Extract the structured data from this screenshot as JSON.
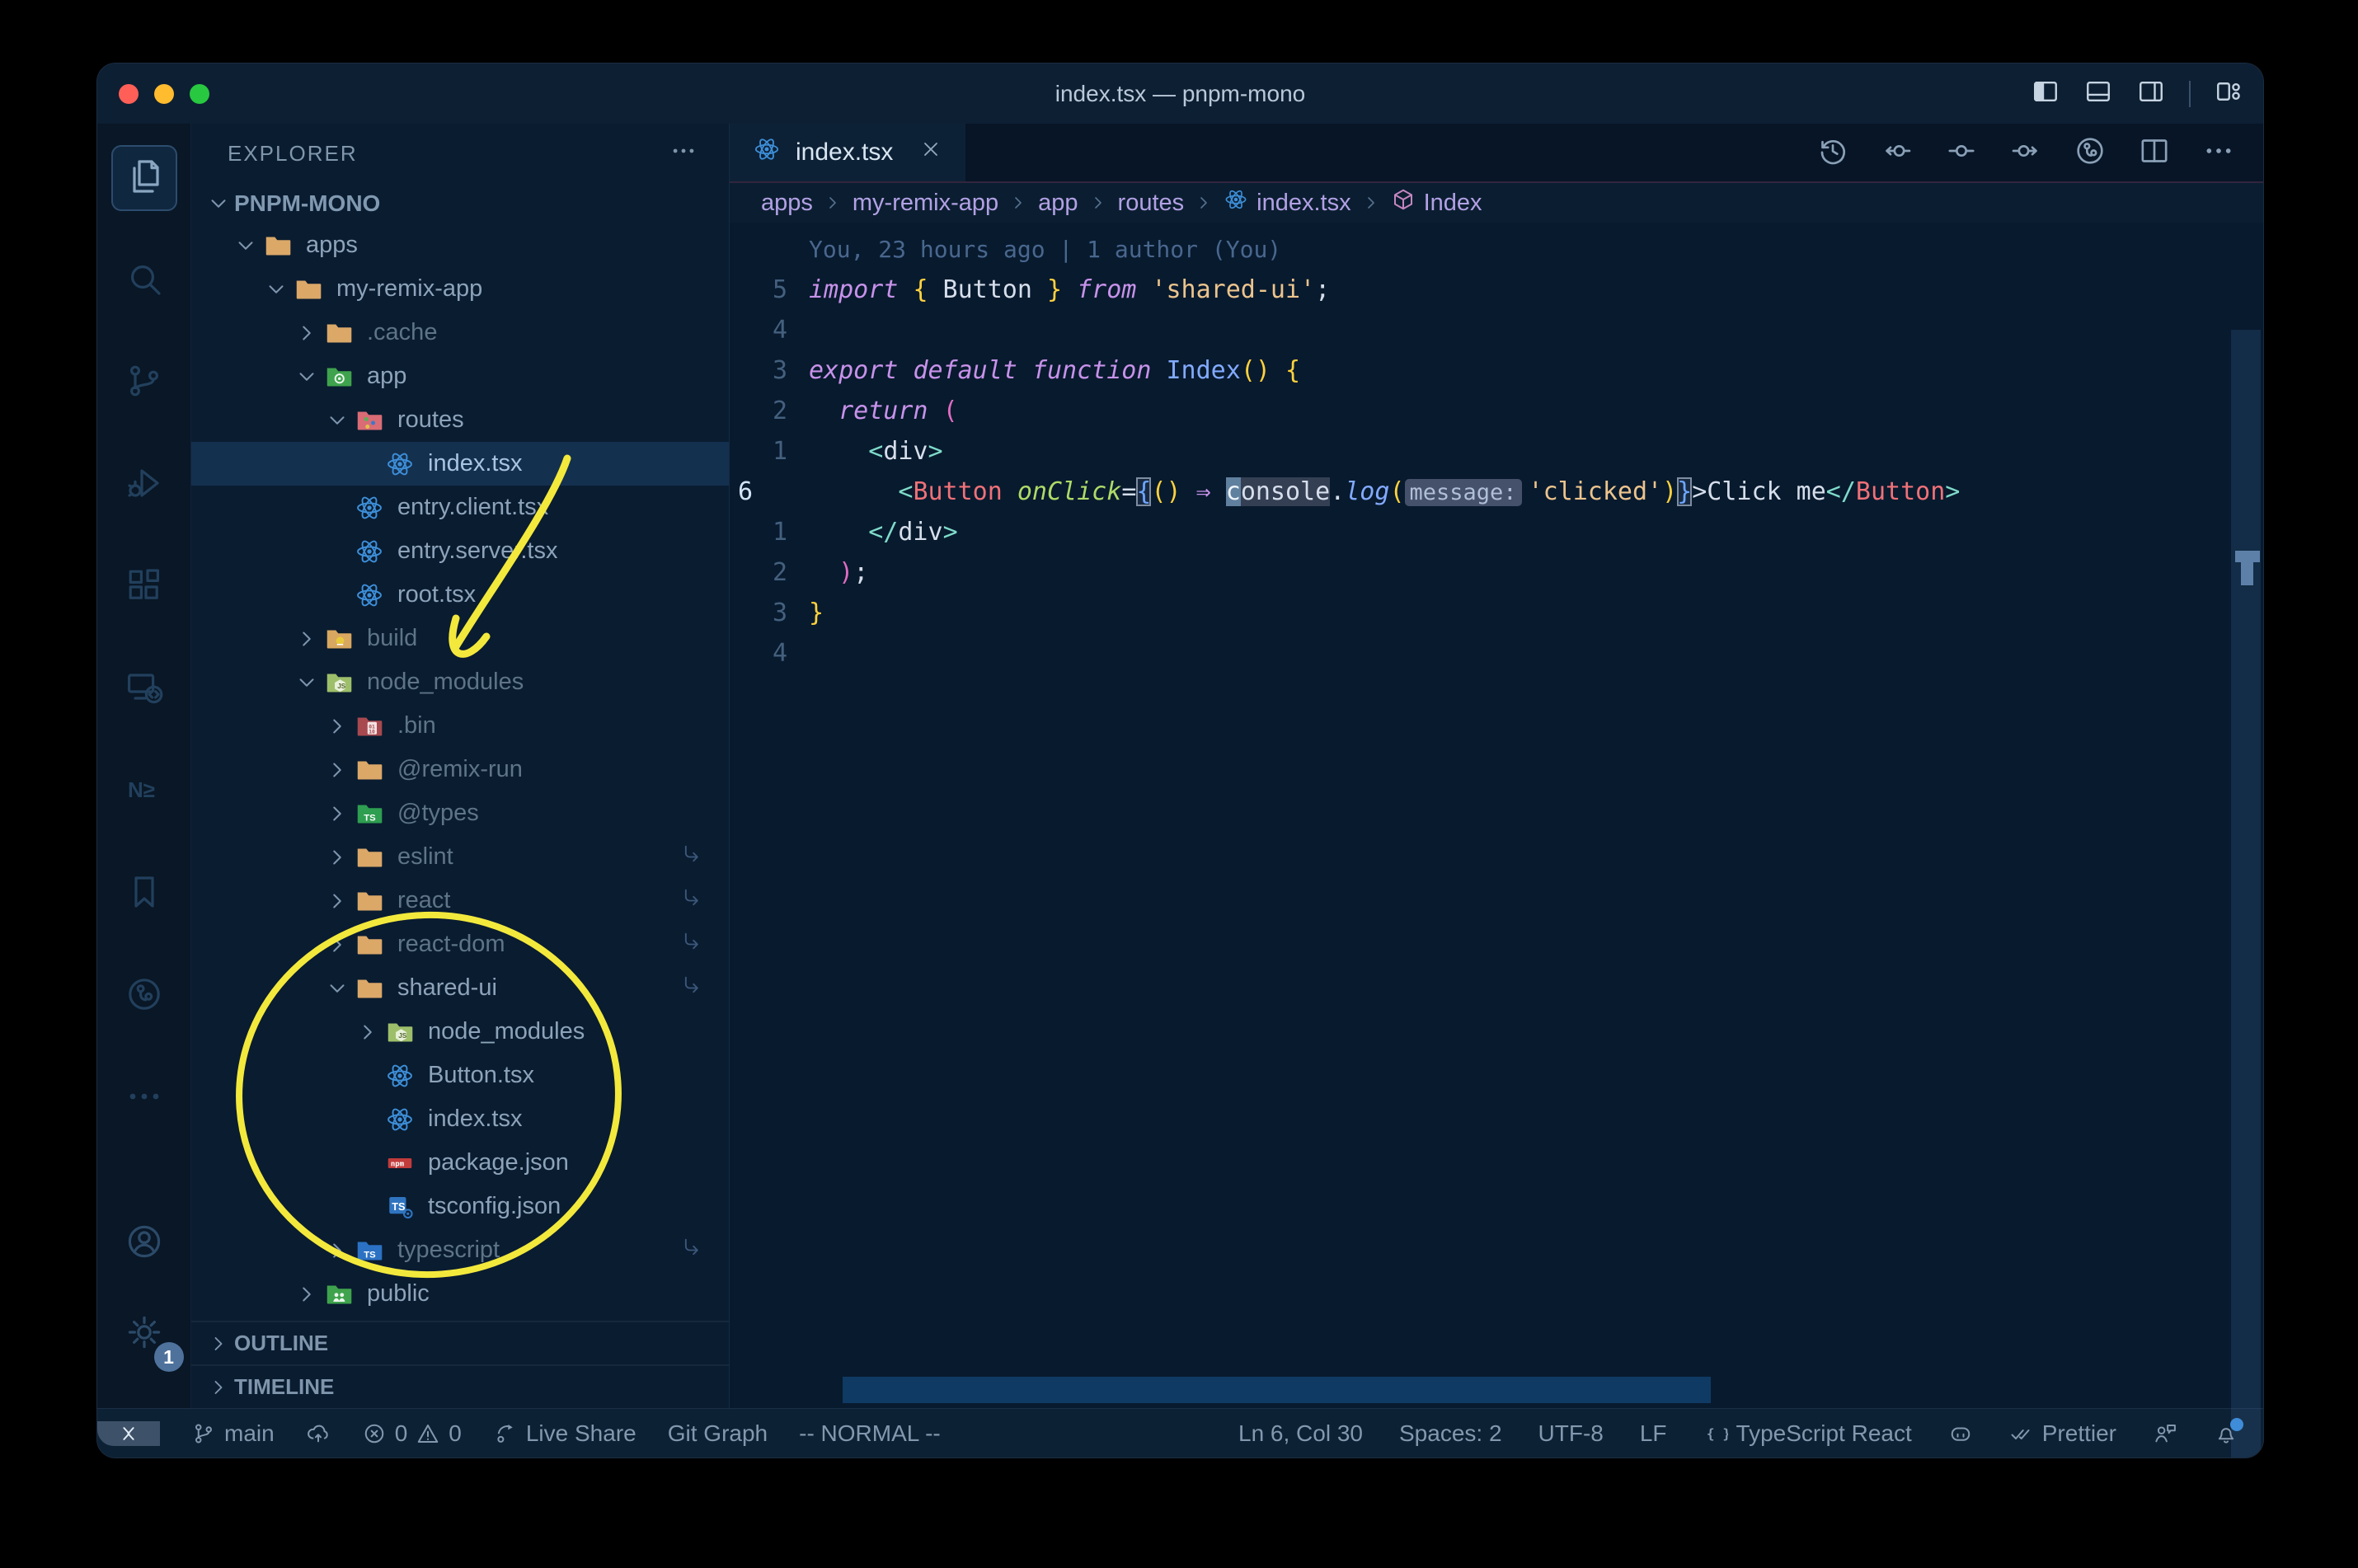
{
  "window": {
    "title": "index.tsx — pnpm-mono"
  },
  "colors": {
    "annotation_yellow": "#f3e93c",
    "traffic_red": "#ff5f57",
    "traffic_yellow": "#febc2e",
    "traffic_green": "#28c840",
    "editor_bg": "#081a2e",
    "statusbar_bg": "#0d2134"
  },
  "activity_bar": {
    "items": [
      {
        "name": "explorer",
        "icon": "files",
        "active": true
      },
      {
        "name": "search",
        "icon": "search"
      },
      {
        "name": "source-control",
        "icon": "scm"
      },
      {
        "name": "run-debug",
        "icon": "debug"
      },
      {
        "name": "extensions",
        "icon": "extensions"
      },
      {
        "name": "remote-explorer",
        "icon": "remote"
      },
      {
        "name": "nx-console",
        "icon": "nx"
      },
      {
        "name": "bookmarks",
        "icon": "bookmark"
      },
      {
        "name": "gitlens",
        "icon": "gitlens"
      },
      {
        "name": "more",
        "icon": "more"
      }
    ],
    "bottom": [
      {
        "name": "accounts",
        "icon": "account"
      },
      {
        "name": "settings",
        "icon": "gear",
        "badge": "1"
      }
    ]
  },
  "sidebar": {
    "header": "EXPLORER",
    "root": "PNPM-MONO",
    "sections": [
      "OUTLINE",
      "TIMELINE"
    ],
    "tree": [
      {
        "label": "apps",
        "depth": 1,
        "icon": "folder",
        "chev": "down"
      },
      {
        "label": "my-remix-app",
        "depth": 2,
        "icon": "folder",
        "chev": "down"
      },
      {
        "label": ".cache",
        "depth": 3,
        "icon": "folder",
        "chev": "right",
        "dim": true
      },
      {
        "label": "app",
        "depth": 3,
        "icon": "folder-app",
        "chev": "down"
      },
      {
        "label": "routes",
        "depth": 4,
        "icon": "folder-routes",
        "chev": "down"
      },
      {
        "label": "index.tsx",
        "depth": 5,
        "icon": "react",
        "selected": true
      },
      {
        "label": "entry.client.tsx",
        "depth": 4,
        "icon": "react"
      },
      {
        "label": "entry.server.tsx",
        "depth": 4,
        "icon": "react"
      },
      {
        "label": "root.tsx",
        "depth": 4,
        "icon": "react"
      },
      {
        "label": "build",
        "depth": 3,
        "icon": "folder-build",
        "chev": "right",
        "dim": true
      },
      {
        "label": "node_modules",
        "depth": 3,
        "icon": "folder-node",
        "chev": "down",
        "dim": true
      },
      {
        "label": ".bin",
        "depth": 4,
        "icon": "file-bin",
        "chev": "right",
        "dim": true
      },
      {
        "label": "@remix-run",
        "depth": 4,
        "icon": "folder",
        "chev": "right",
        "dim": true
      },
      {
        "label": "@types",
        "depth": 4,
        "icon": "folder-types",
        "chev": "right",
        "dim": true
      },
      {
        "label": "eslint",
        "depth": 4,
        "icon": "folder",
        "chev": "right",
        "dim": true,
        "symlink": true
      },
      {
        "label": "react",
        "depth": 4,
        "icon": "folder",
        "chev": "right",
        "dim": true,
        "symlink": true
      },
      {
        "label": "react-dom",
        "depth": 4,
        "icon": "folder",
        "chev": "right",
        "dim": true,
        "symlink": true
      },
      {
        "label": "shared-ui",
        "depth": 4,
        "icon": "folder",
        "chev": "down",
        "symlink": true
      },
      {
        "label": "node_modules",
        "depth": 5,
        "icon": "folder-node",
        "chev": "right"
      },
      {
        "label": "Button.tsx",
        "depth": 5,
        "icon": "react"
      },
      {
        "label": "index.tsx",
        "depth": 5,
        "icon": "react"
      },
      {
        "label": "package.json",
        "depth": 5,
        "icon": "npm"
      },
      {
        "label": "tsconfig.json",
        "depth": 5,
        "icon": "ts-config"
      },
      {
        "label": "typescript",
        "depth": 4,
        "icon": "folder-ts",
        "chev": "right",
        "dim": true,
        "symlink": true
      },
      {
        "label": "public",
        "depth": 3,
        "icon": "folder-public",
        "chev": "right"
      }
    ]
  },
  "tab": {
    "label": "index.tsx"
  },
  "editor_toolbar": [
    {
      "name": "timeline",
      "icon": "history"
    },
    {
      "name": "nav-back",
      "icon": "node-left"
    },
    {
      "name": "nav-node",
      "icon": "node-mid"
    },
    {
      "name": "nav-forward",
      "icon": "node-right"
    },
    {
      "name": "gitlens-graph",
      "icon": "gitlens"
    },
    {
      "name": "split-editor",
      "icon": "split"
    },
    {
      "name": "more-actions",
      "icon": "more"
    }
  ],
  "layout_controls": [
    {
      "name": "toggle-primary-sidebar",
      "icon": "layout-left"
    },
    {
      "name": "toggle-panel",
      "icon": "layout-bottom"
    },
    {
      "name": "toggle-secondary-sidebar",
      "icon": "layout-right"
    },
    {
      "name": "customize-layout",
      "icon": "layout-custom",
      "sep_before": true
    }
  ],
  "breadcrumbs": [
    {
      "label": "apps"
    },
    {
      "label": "my-remix-app"
    },
    {
      "label": "app"
    },
    {
      "label": "routes"
    },
    {
      "label": "index.tsx",
      "icon": "react"
    },
    {
      "label": "Index",
      "icon": "symbol-cube"
    }
  ],
  "editor": {
    "blame": "You, 23 hours ago | 1 author (You)",
    "lines": [
      {
        "num": "5",
        "tokens": [
          [
            "import",
            "kw"
          ],
          [
            " ",
            ""
          ],
          [
            "{",
            "b1"
          ],
          [
            " Button ",
            "wh"
          ],
          [
            "}",
            "b1"
          ],
          [
            " ",
            ""
          ],
          [
            "from",
            "kw"
          ],
          [
            " ",
            ""
          ],
          [
            "'shared-ui'",
            "str"
          ],
          [
            ";",
            "wh"
          ]
        ]
      },
      {
        "num": "4",
        "tokens": []
      },
      {
        "num": "3",
        "tokens": [
          [
            "export",
            "kw"
          ],
          [
            " ",
            ""
          ],
          [
            "default",
            "kw"
          ],
          [
            " ",
            ""
          ],
          [
            "function",
            "kw"
          ],
          [
            " ",
            ""
          ],
          [
            "Index",
            "fn"
          ],
          [
            "(",
            "b1"
          ],
          [
            ")",
            "b1"
          ],
          [
            " ",
            ""
          ],
          [
            "{",
            "b1"
          ]
        ]
      },
      {
        "num": "2",
        "tokens": [
          [
            "  ",
            ""
          ],
          [
            "return",
            "kw"
          ],
          [
            " ",
            ""
          ],
          [
            "(",
            "b2"
          ]
        ]
      },
      {
        "num": "1",
        "tokens": [
          [
            "    ",
            ""
          ],
          [
            "<",
            "teal"
          ],
          [
            "div",
            "wh"
          ],
          [
            ">",
            "teal"
          ]
        ]
      },
      {
        "num": "6",
        "current": true,
        "tokens": [
          [
            "      ",
            ""
          ],
          [
            "<",
            "teal"
          ],
          [
            "Button",
            "tag"
          ],
          [
            " ",
            ""
          ],
          [
            "onClick",
            "attr"
          ],
          [
            "=",
            "wh"
          ],
          [
            "{",
            "b3 boxed"
          ],
          [
            "(",
            "b1"
          ],
          [
            ")",
            "b1"
          ],
          [
            " ",
            ""
          ],
          [
            "⇒",
            "kw"
          ],
          [
            " ",
            ""
          ],
          [
            "c",
            "wh cursor"
          ],
          [
            "onsole",
            "wh hl"
          ],
          [
            ".",
            "wh"
          ],
          [
            "log",
            "fni"
          ],
          [
            "(",
            "b1"
          ],
          [
            "message:",
            "inlay"
          ],
          [
            "'clicked'",
            "str"
          ],
          [
            ")",
            "b1"
          ],
          [
            "}",
            "b3 boxed"
          ],
          [
            ">",
            "wh"
          ],
          [
            "Click me",
            "wh"
          ],
          [
            "</",
            "teal"
          ],
          [
            "Button",
            "tag"
          ],
          [
            ">",
            "teal"
          ]
        ]
      },
      {
        "num": "1",
        "tokens": [
          [
            "    ",
            ""
          ],
          [
            "</",
            "teal"
          ],
          [
            "div",
            "wh"
          ],
          [
            ">",
            "teal"
          ]
        ]
      },
      {
        "num": "2",
        "tokens": [
          [
            "  ",
            ""
          ],
          [
            ")",
            "b2"
          ],
          [
            ";",
            "wh"
          ]
        ]
      },
      {
        "num": "3",
        "tokens": [
          [
            "}",
            "b1"
          ]
        ]
      },
      {
        "num": "4",
        "tokens": []
      }
    ]
  },
  "status_bar": {
    "left": [
      {
        "name": "remote-indicator",
        "remote": true,
        "parts": [
          {
            "icon": "remote-status"
          }
        ]
      },
      {
        "name": "git-branch",
        "parts": [
          {
            "icon": "branch"
          },
          {
            "text": "main"
          }
        ]
      },
      {
        "name": "sync",
        "parts": [
          {
            "icon": "cloud-up"
          }
        ]
      },
      {
        "name": "problems",
        "parts": [
          {
            "icon": "error"
          },
          {
            "text": "0"
          },
          {
            "icon": "warning"
          },
          {
            "text": "0"
          }
        ]
      },
      {
        "name": "live-share",
        "parts": [
          {
            "icon": "live-share"
          },
          {
            "text": "Live Share"
          }
        ]
      },
      {
        "name": "git-graph",
        "parts": [
          {
            "text": "Git Graph"
          }
        ]
      },
      {
        "name": "vim-mode",
        "parts": [
          {
            "text": "-- NORMAL --"
          }
        ]
      }
    ],
    "right": [
      {
        "name": "cursor-position",
        "parts": [
          {
            "text": "Ln 6, Col 30"
          }
        ]
      },
      {
        "name": "indentation",
        "parts": [
          {
            "text": "Spaces: 2"
          }
        ]
      },
      {
        "name": "encoding",
        "parts": [
          {
            "text": "UTF-8"
          }
        ]
      },
      {
        "name": "eol",
        "parts": [
          {
            "text": "LF"
          }
        ]
      },
      {
        "name": "language-mode",
        "parts": [
          {
            "icon": "braces"
          },
          {
            "text": "TypeScript React"
          }
        ]
      },
      {
        "name": "copilot",
        "parts": [
          {
            "icon": "copilot"
          }
        ]
      },
      {
        "name": "prettier",
        "parts": [
          {
            "icon": "double-check"
          },
          {
            "text": "Prettier"
          }
        ]
      },
      {
        "name": "feedback",
        "parts": [
          {
            "icon": "feedback"
          }
        ]
      },
      {
        "name": "notifications",
        "bell": true,
        "parts": [
          {
            "icon": "bell"
          }
        ]
      }
    ]
  }
}
